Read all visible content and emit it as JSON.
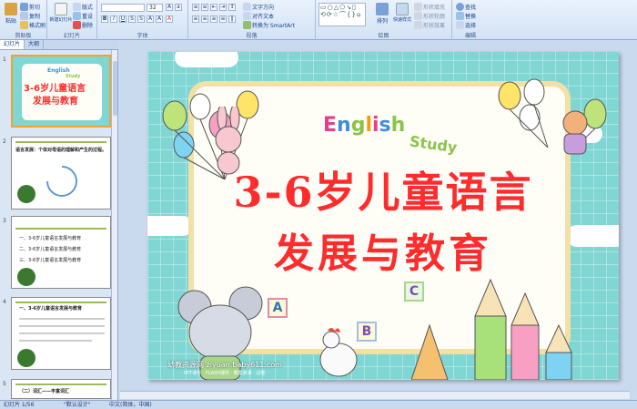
{
  "ribbon": {
    "clipboard": {
      "paste": "粘贴",
      "cut": "剪切",
      "copy": "复制",
      "format_painter": "格式刷",
      "label": "剪贴板"
    },
    "slides": {
      "new_slide": "新建幻灯片",
      "layout": "版式",
      "reset": "重设",
      "delete": "删除",
      "label": "幻灯片"
    },
    "font": {
      "font_name": "",
      "font_size": "32",
      "label": "字体"
    },
    "paragraph": {
      "text_direction": "文字方向",
      "align_text": "对齐文本",
      "smartart": "转换为 SmartArt",
      "label": "段落"
    },
    "drawing": {
      "arrange": "排列",
      "quick_styles": "快速样式",
      "shape_fill": "形状填充",
      "shape_outline": "形状轮廓",
      "shape_effects": "形状效果",
      "label": "绘图"
    },
    "editing": {
      "find": "查找",
      "replace": "替换",
      "select": "选择",
      "label": "编辑"
    }
  },
  "left_panel": {
    "tabs": [
      "幻灯片",
      "大纲"
    ],
    "thumbnails": [
      {
        "num": "1",
        "title_line1": "3-6岁儿童语言",
        "title_line2": "发展与教育",
        "english": "English",
        "study": "Study"
      },
      {
        "num": "2",
        "text": "语言发展：个体对母语的理解和产生的过程。"
      },
      {
        "num": "3",
        "lines": [
          "一、3-6岁儿童语言发展与教育",
          "二、3-6岁儿童语言发展与教育",
          "三、3-6岁儿童语言发展与教育"
        ]
      },
      {
        "num": "4",
        "title": "一、3-6岁儿童语言发展与教育"
      },
      {
        "num": "5",
        "title": "（二）词汇——丰富词汇"
      }
    ]
  },
  "slide": {
    "english": "English",
    "study": "Study",
    "title_line1": "3-6岁儿童语言",
    "title_line2": "发展与教育",
    "cube_a": "A",
    "cube_b": "B",
    "cube_c": "C",
    "watermark": "幼教资源网 ziyuan.baby611.com",
    "watermark_sub": "PPT课件 · FLASH课件 · 教案故事 · 试卷"
  },
  "status": {
    "slide_pos": "幻灯片 1/56",
    "theme": "\"默认设计\"",
    "lang": "中文(简体，中国)"
  },
  "colors": {
    "accent": "#f3a22c",
    "title_red": "#ff2c2c",
    "slide_bg": "#7fd6d2"
  }
}
